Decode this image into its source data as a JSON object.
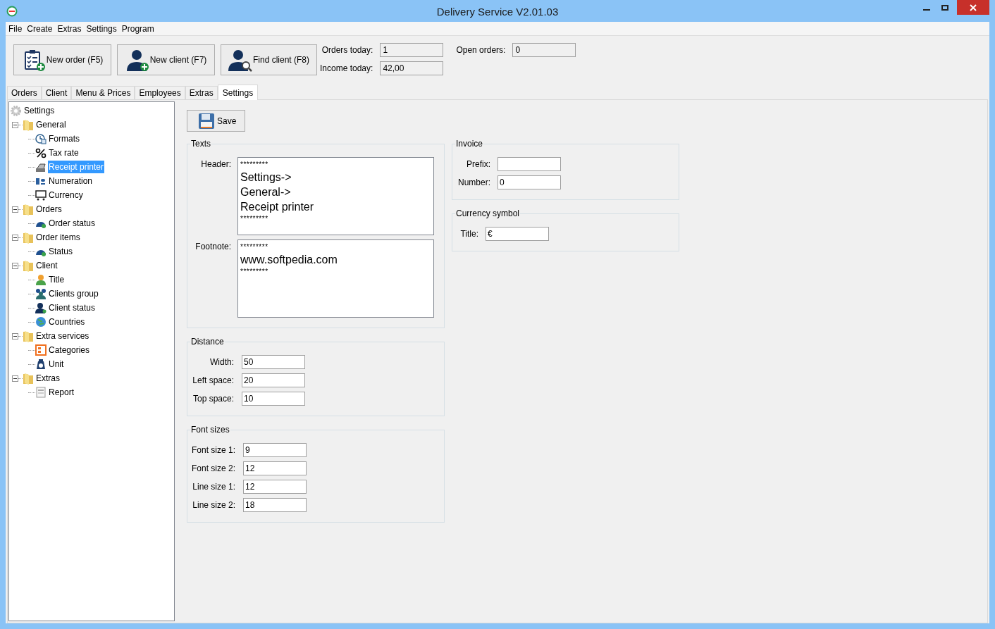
{
  "window": {
    "title": "Delivery Service V2.01.03"
  },
  "menu": [
    "File",
    "Create",
    "Extras",
    "Settings",
    "Program"
  ],
  "toolbar": {
    "buttons": [
      "New order (F5)",
      "New client (F7)",
      "Find client (F8)"
    ],
    "stats": [
      {
        "label": "Orders today:",
        "value": "1"
      },
      {
        "label": "Open orders:",
        "value": "0"
      },
      {
        "label": "Income today:",
        "value": "42,00"
      }
    ]
  },
  "tabs": [
    {
      "label": "Orders",
      "selected": false
    },
    {
      "label": "Client",
      "selected": false
    },
    {
      "label": "Menu & Prices",
      "selected": false
    },
    {
      "label": "Employees",
      "selected": false
    },
    {
      "label": "Extras",
      "selected": false
    },
    {
      "label": "Settings",
      "selected": true
    }
  ],
  "tree": {
    "label": "Settings",
    "selected": false,
    "children": [
      {
        "label": "General",
        "selected": false,
        "expanded": true,
        "children": [
          {
            "label": "Formats",
            "selected": false
          },
          {
            "label": "Tax rate",
            "selected": false
          },
          {
            "label": "Receipt printer",
            "selected": true
          },
          {
            "label": "Numeration",
            "selected": false
          },
          {
            "label": "Currency",
            "selected": false
          }
        ]
      },
      {
        "label": "Orders",
        "selected": false,
        "expanded": true,
        "children": [
          {
            "label": "Order status",
            "selected": false
          }
        ]
      },
      {
        "label": "Order items",
        "selected": false,
        "expanded": true,
        "children": [
          {
            "label": "Status",
            "selected": false
          }
        ]
      },
      {
        "label": "Client",
        "selected": false,
        "expanded": true,
        "children": [
          {
            "label": "Title",
            "selected": false
          },
          {
            "label": "Clients group",
            "selected": false
          },
          {
            "label": "Client status",
            "selected": false
          },
          {
            "label": "Countries",
            "selected": false
          }
        ]
      },
      {
        "label": "Extra services",
        "selected": false,
        "expanded": true,
        "children": [
          {
            "label": "Categories",
            "selected": false
          },
          {
            "label": "Unit",
            "selected": false
          }
        ]
      },
      {
        "label": "Extras",
        "selected": false,
        "expanded": true,
        "children": [
          {
            "label": "Report",
            "selected": false
          }
        ]
      }
    ]
  },
  "save_button": "Save",
  "texts": {
    "title": "Texts",
    "fields": [
      {
        "label": "Header:",
        "lines": [
          {
            "kind": "small",
            "text": "*********"
          },
          {
            "kind": "large",
            "text": "Settings->"
          },
          {
            "kind": "large",
            "text": "General->"
          },
          {
            "kind": "large",
            "text": "Receipt printer"
          },
          {
            "kind": "small",
            "text": "*********"
          }
        ]
      },
      {
        "label": "Footnote:",
        "lines": [
          {
            "kind": "small",
            "text": "*********"
          },
          {
            "kind": "large",
            "text": "www.softpedia.com"
          },
          {
            "kind": "small",
            "text": "*********"
          }
        ]
      }
    ]
  },
  "distance": {
    "title": "Distance",
    "fields": [
      {
        "label": "Width:",
        "value": "50"
      },
      {
        "label": "Left space:",
        "value": "20"
      },
      {
        "label": "Top space:",
        "value": "10"
      }
    ]
  },
  "font_sizes": {
    "title": "Font sizes",
    "fields": [
      {
        "label": "Font size 1:",
        "value": "9"
      },
      {
        "label": "Font size 2:",
        "value": "12"
      },
      {
        "label": "Line size 1:",
        "value": "12"
      },
      {
        "label": "Line size 2:",
        "value": "18"
      }
    ]
  },
  "invoice": {
    "title": "Invoice",
    "fields": [
      {
        "label": "Prefix:"
      },
      {
        "label": "Number:",
        "value": "0"
      }
    ]
  },
  "currency_symbol": {
    "title": "Currency symbol",
    "fields": [
      {
        "label": "Title:",
        "value": "€"
      }
    ]
  }
}
